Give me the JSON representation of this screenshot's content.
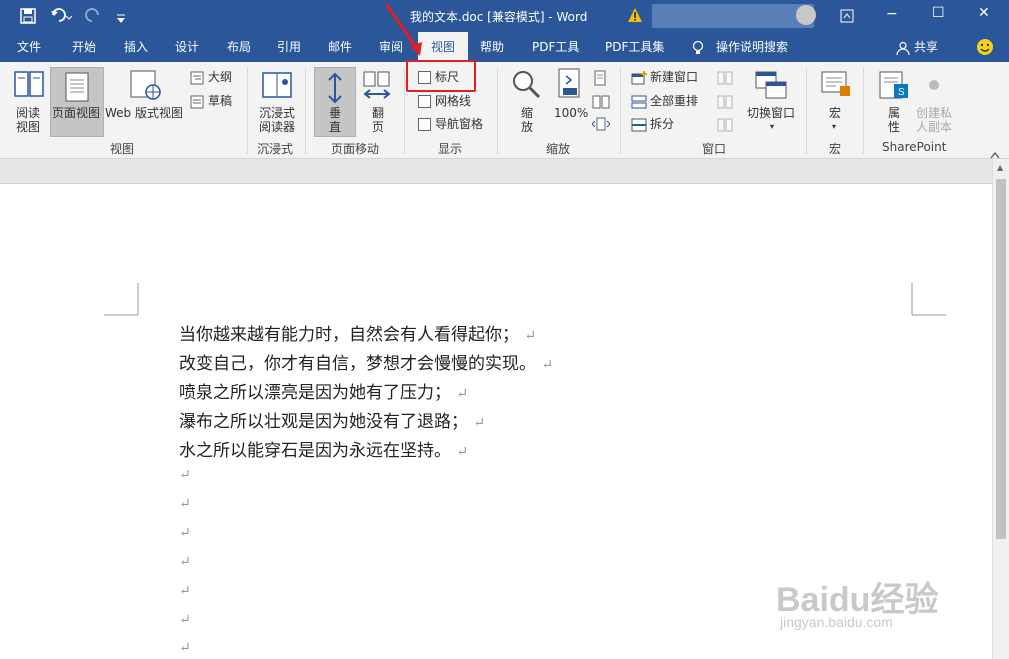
{
  "window": {
    "title": "我的文本.doc [兼容模式]  -  Word",
    "controls": [
      "−",
      "☐",
      "✕"
    ]
  },
  "tabs": [
    "文件",
    "开始",
    "插入",
    "设计",
    "布局",
    "引用",
    "邮件",
    "审阅",
    "视图",
    "帮助",
    "PDF工具",
    "PDF工具集"
  ],
  "active_tab": "视图",
  "search": {
    "label": "操作说明搜索"
  },
  "share": {
    "label": "共享"
  },
  "ribbon": {
    "views": {
      "read_mode": "阅读\n视图",
      "print_layout": "页面视图",
      "web_layout": "Web 版式视图",
      "outline": "大纲",
      "draft": "草稿",
      "group_label": "视图"
    },
    "immersive": {
      "reader": "沉浸式\n阅读器",
      "group_label": "沉浸式"
    },
    "page_movement": {
      "vertical": "垂\n直",
      "side_to_side": "翻\n页",
      "group_label": "页面移动"
    },
    "show": {
      "ruler": "标尺",
      "gridlines": "网格线",
      "nav_pane": "导航窗格",
      "group_label": "显示"
    },
    "zoom": {
      "zoom": "缩\n放",
      "hundred": "100%",
      "group_label": "缩放"
    },
    "window": {
      "new_window": "新建窗口",
      "arrange_all": "全部重排",
      "split": "拆分",
      "switch": "切换窗口",
      "group_label": "窗口"
    },
    "macros": {
      "macro": "宏",
      "group_label": "宏"
    },
    "sharepoint": {
      "properties": "属\n性",
      "private_copy": "创建私\n人副本",
      "group_label": "SharePoint"
    }
  },
  "document": {
    "lines": [
      "当你越来越有能力时，自然会有人看得起你；",
      "改变自己，你才有自信，梦想才会慢慢的实现。",
      "喷泉之所以漂亮是因为她有了压力；",
      "瀑布之所以壮观是因为她没有了退路；",
      "水之所以能穿石是因为永远在坚持。"
    ],
    "para_mark": "↵",
    "empty_paragraphs": 7
  },
  "watermark": {
    "brand": "Baidu经验",
    "url": "jingyan.baidu.com"
  },
  "colors": {
    "title_bar": "#2b579a",
    "ribbon": "#f3f3f3",
    "highlight": "#e02020"
  }
}
